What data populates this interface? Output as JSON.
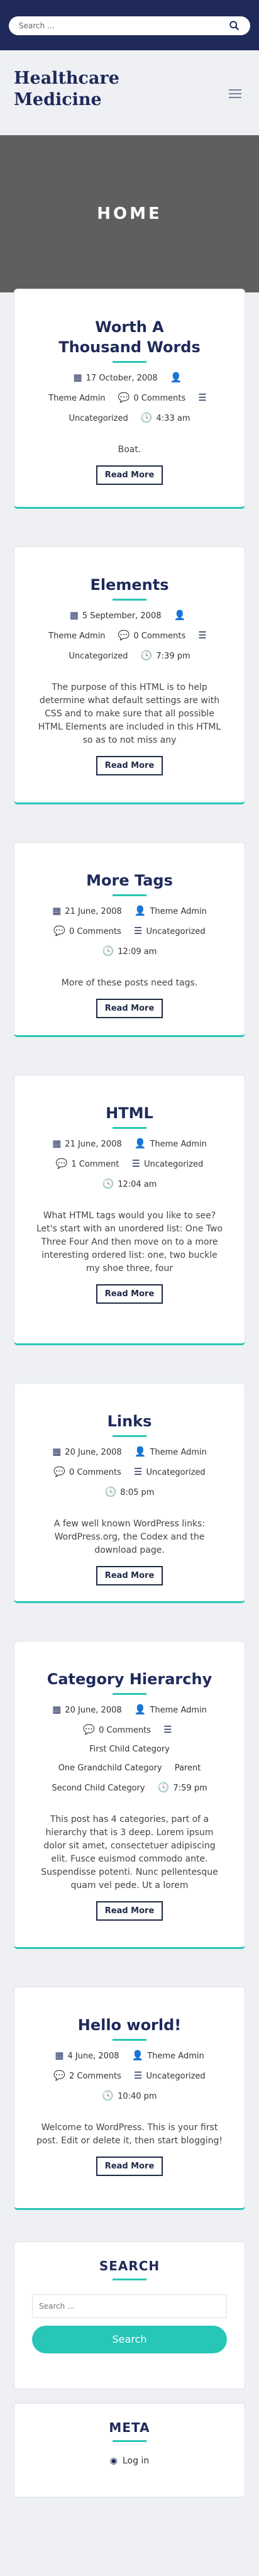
{
  "header": {
    "search_placeholder": "Search ...",
    "site_title": "Healthcare Medicine",
    "hero_title": "HOME"
  },
  "posts": [
    {
      "title": "Worth A Thousand Words",
      "date": "17 October, 2008",
      "author": "Theme Admin",
      "comments": "0 Comments",
      "category": "Uncategorized",
      "time": "4:33 am",
      "excerpt": "Boat.",
      "read_more": "Read More"
    },
    {
      "title": "Elements",
      "date": "5 September, 2008",
      "author": "Theme Admin",
      "comments": "0 Comments",
      "category": "Uncategorized",
      "time": "7:39 pm",
      "excerpt": "The purpose of this HTML is to help determine what default settings are with CSS and to make sure that all possible HTML Elements are included in this HTML so as to not miss any",
      "read_more": "Read More"
    },
    {
      "title": "More Tags",
      "date": "21 June, 2008",
      "author": "Theme Admin",
      "comments": "0 Comments",
      "category": "Uncategorized",
      "time": "12:09 am",
      "excerpt": "More of these posts need tags.",
      "read_more": "Read More"
    },
    {
      "title": "HTML",
      "date": "21 June, 2008",
      "author": "Theme Admin",
      "comments": "1 Comment",
      "category": "Uncategorized",
      "time": "12:04 am",
      "excerpt": "What HTML tags would you like to see? Let's start with an unordered list: One Two Three Four And then move on to a more interesting ordered list: one, two buckle my shoe three, four",
      "read_more": "Read More"
    },
    {
      "title": "Links",
      "date": "20 June, 2008",
      "author": "Theme Admin",
      "comments": "0 Comments",
      "category": "Uncategorized",
      "time": "8:05 pm",
      "excerpt": "A few well known WordPress links: WordPress.org, the Codex and the download page.",
      "read_more": "Read More"
    },
    {
      "title": "Category Hierarchy",
      "date": "20 June, 2008",
      "author": "Theme Admin",
      "comments": "0 Comments",
      "category": "First Child Category",
      "categories_extra": [
        "One Grandchild Category",
        "Parent",
        "Second Child Category"
      ],
      "time": "7:59 pm",
      "excerpt": "This post has 4 categories, part of a hierarchy that is 3 deep. Lorem ipsum dolor sit amet, consectetuer adipiscing elit. Fusce euismod commodo ante. Suspendisse potenti. Nunc pellentesque quam vel pede. Ut a lorem",
      "read_more": "Read More"
    },
    {
      "title": "Hello world!",
      "date": "4 June, 2008",
      "author": "Theme Admin",
      "comments": "2 Comments",
      "category": "Uncategorized",
      "time": "10:40 pm",
      "excerpt": "Welcome to WordPress. This is your first post. Edit or delete it, then start blogging!",
      "read_more": "Read More"
    }
  ],
  "widgets": {
    "search": {
      "title": "SEARCH",
      "placeholder": "Search ...",
      "button": "Search"
    },
    "meta": {
      "title": "META",
      "login": "Log in"
    }
  },
  "colors": {
    "navy": "#1f2a5a",
    "accent": "#27c6b6",
    "hero": "#5f5f5f"
  }
}
